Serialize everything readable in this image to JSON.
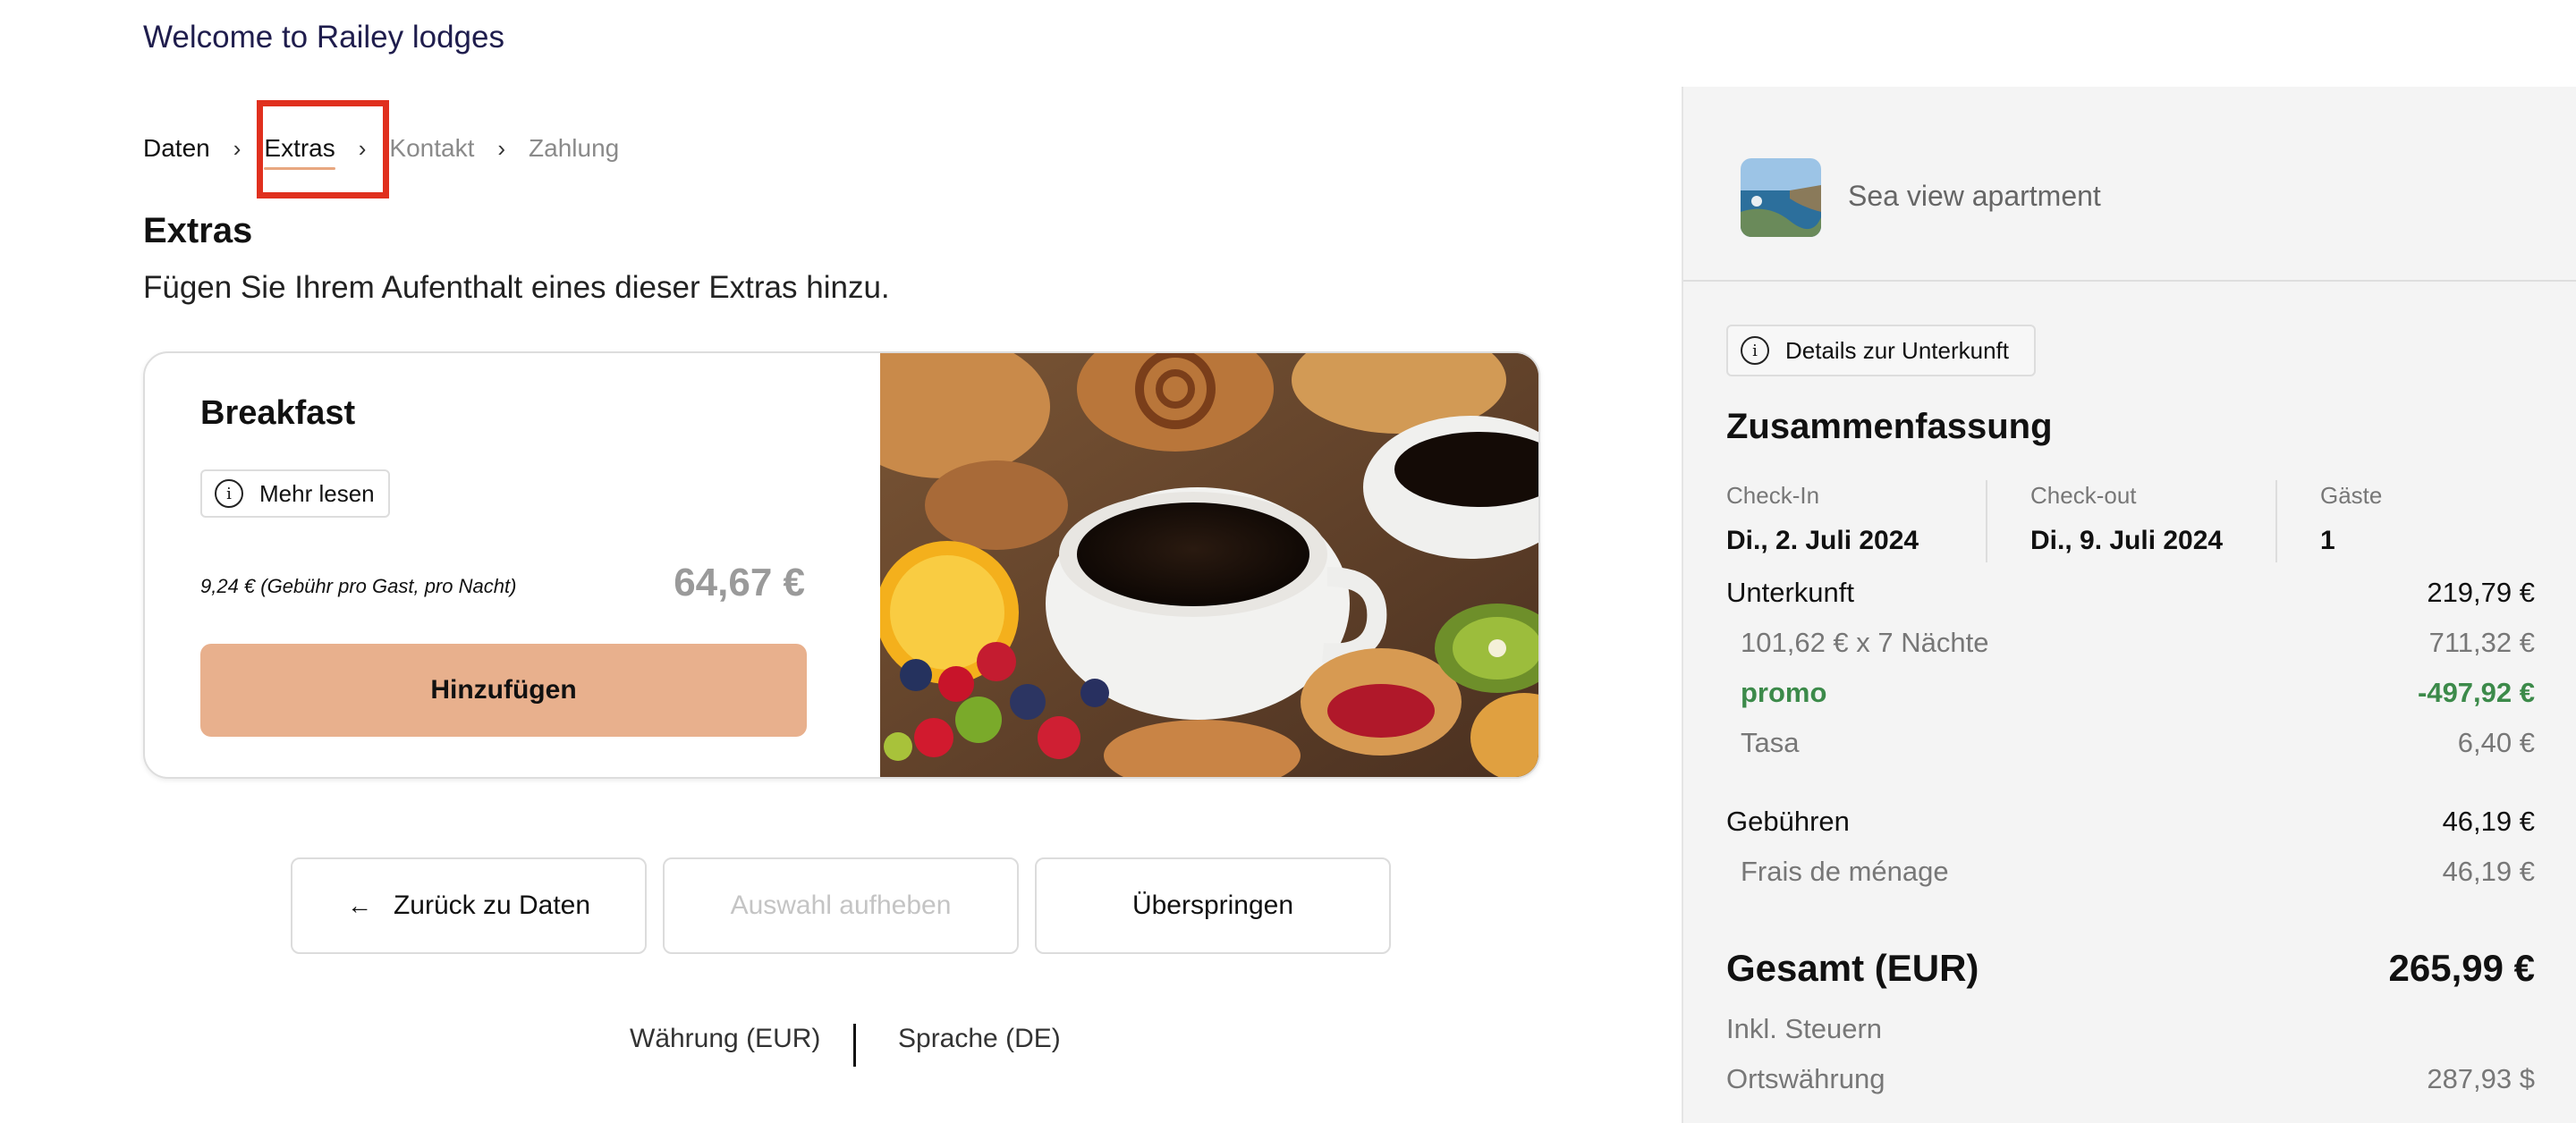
{
  "header": {
    "welcome": "Welcome to Railey lodges"
  },
  "steps": [
    {
      "label": "Daten",
      "state": "done"
    },
    {
      "label": "Extras",
      "state": "active"
    },
    {
      "label": "Kontakt",
      "state": "upcoming"
    },
    {
      "label": "Zahlung",
      "state": "upcoming"
    }
  ],
  "extras": {
    "heading": "Extras",
    "subtitle": "Fügen Sie Ihrem Aufenthalt eines dieser Extras hinzu.",
    "card": {
      "title": "Breakfast",
      "more_label": "Mehr lesen",
      "price_note": "9,24 € (Gebühr pro Gast, pro Nacht)",
      "price": "64,67 €",
      "add_label": "Hinzufügen"
    }
  },
  "nav": {
    "back_label": "Zurück zu Daten",
    "clear_label": "Auswahl aufheben",
    "skip_label": "Überspringen"
  },
  "footer": {
    "currency": "Währung (EUR)",
    "language": "Sprache (DE)"
  },
  "summary": {
    "apartment": "Sea view apartment",
    "details_label": "Details zur Unterkunft",
    "title": "Zusammenfassung",
    "checkin_label": "Check-In",
    "checkin_value": "Di., 2. Juli 2024",
    "checkout_label": "Check-out",
    "checkout_value": "Di., 9. Juli 2024",
    "guests_label": "Gäste",
    "guests_value": "1",
    "accommodation_label": "Unterkunft",
    "accommodation_value": "219,79 €",
    "nights_label": "101,62 € x 7 Nächte",
    "nights_value": "711,32 €",
    "promo_label": "promo",
    "promo_value": "-497,92 €",
    "tasa_label": "Tasa",
    "tasa_value": "6,40 €",
    "fees_label": "Gebühren",
    "fees_value": "46,19 €",
    "cleaning_label": "Frais de ménage",
    "cleaning_value": "46,19 €",
    "total_label": "Gesamt (EUR)",
    "total_value": "265,99 €",
    "tax_note": "Inkl. Steuern",
    "local_label": "Ortswährung",
    "local_value": "287,93 $"
  },
  "colors": {
    "accent": "#e8b08d",
    "promo": "#3c8a4a",
    "highlight": "#e0301e",
    "brand_text": "#1f1d4d"
  }
}
